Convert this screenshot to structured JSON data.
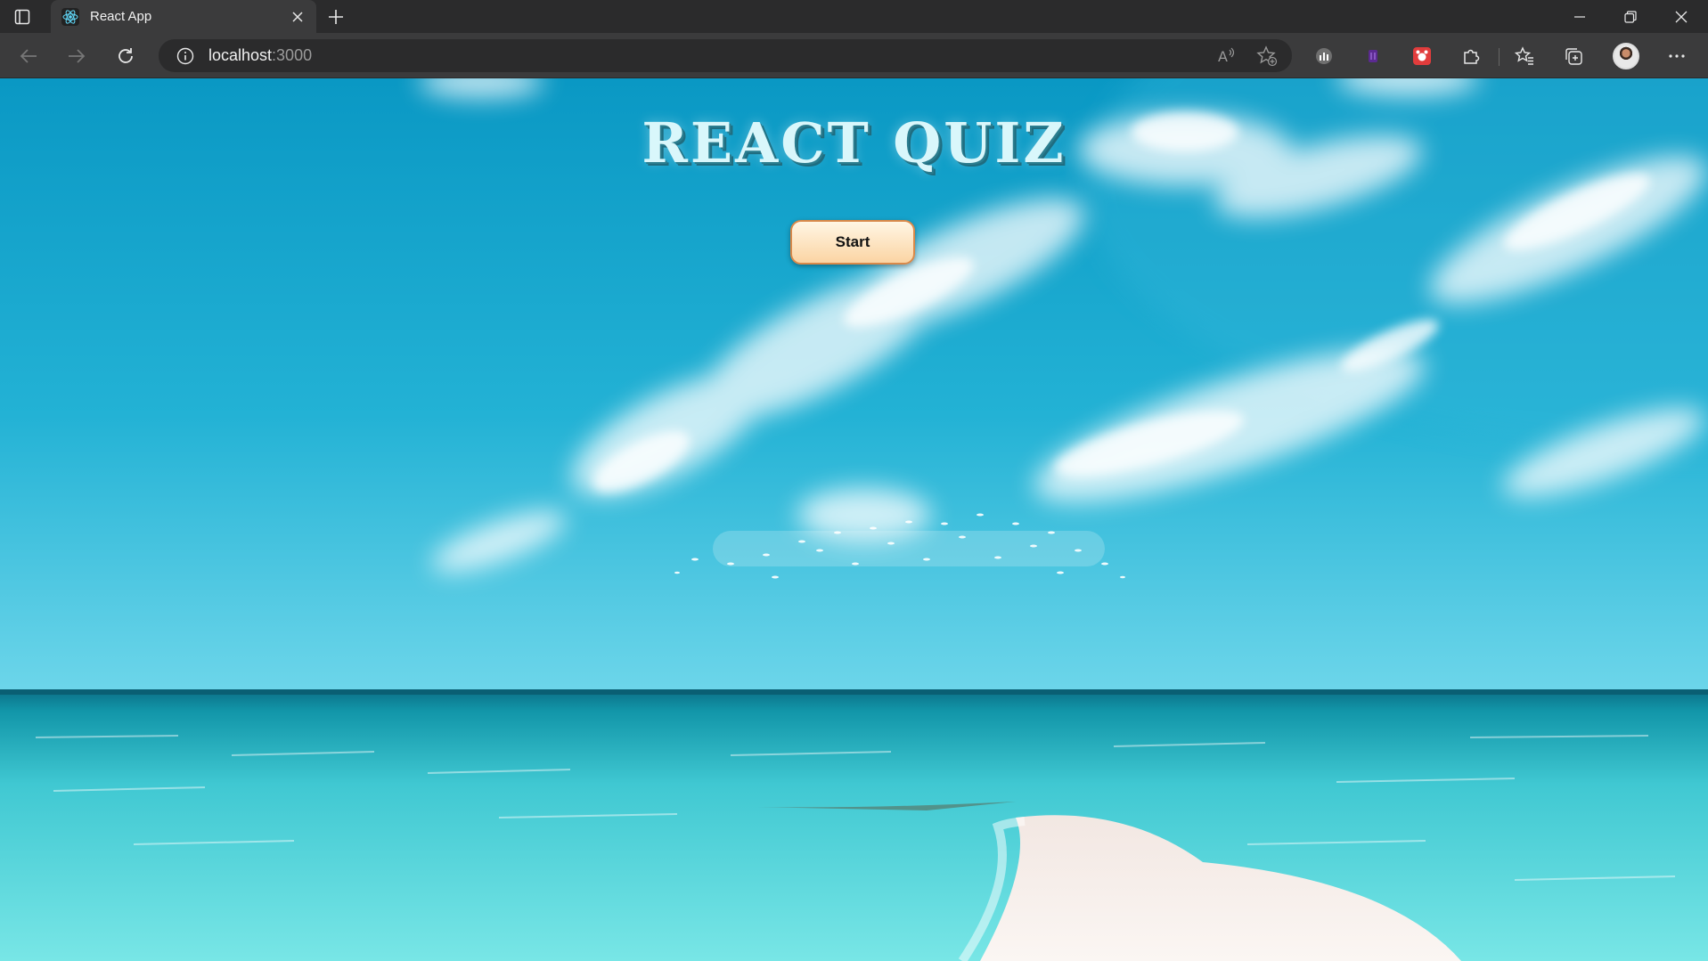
{
  "browser": {
    "tab": {
      "title": "React App",
      "favicon": "react-atom-icon"
    },
    "address_bar": {
      "host": "localhost",
      "port": ":3000"
    },
    "toolbar_icons": [
      "read-aloud-icon",
      "add-favorite-icon",
      "extension-stats-icon",
      "extension-purple-icon",
      "extension-red-icon",
      "extensions-puzzle-icon",
      "favorites-icon",
      "collections-icon",
      "profile-avatar",
      "more-menu-icon"
    ]
  },
  "page": {
    "title": "REACT QUIZ",
    "start_label": "Start"
  },
  "colors": {
    "sky_top": "#0d9cc6",
    "sky_horizon": "#5ad0e6",
    "sea_deep": "#0f7f95",
    "sea_shallow": "#62e2e4",
    "sand": "#f4ecea",
    "button_fill": "#fbd4a3",
    "button_border": "#d9894a"
  }
}
